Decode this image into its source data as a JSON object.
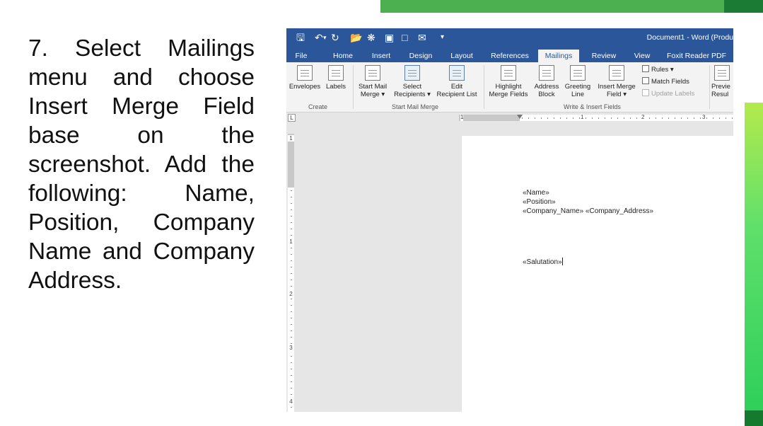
{
  "instruction_text": "7. Select Mailings menu and choose Insert Merge Field base on the screenshot. Add the following: Name, Position, Company Name and Company Address.",
  "word": {
    "window_title": "Document1 - Word (Produ",
    "quick_access_icons": [
      "save-icon",
      "undo-icon",
      "redo-icon",
      "open-icon",
      "customize-icon",
      "print-preview-icon",
      "new-document-icon",
      "email-icon",
      "dropdown-icon"
    ],
    "tabs": [
      "File",
      "Home",
      "Insert",
      "Design",
      "Layout",
      "References",
      "Mailings",
      "Review",
      "View",
      "Foxit Reader PDF"
    ],
    "active_tab": "Mailings",
    "ribbon": {
      "create": {
        "label": "Create",
        "envelopes": "Envelopes",
        "labels": "Labels"
      },
      "start_mail_merge": {
        "label": "Start Mail Merge",
        "start_line1": "Start Mail",
        "start_line2": "Merge ▾",
        "select_line1": "Select",
        "select_line2": "Recipients ▾",
        "edit_line1": "Edit",
        "edit_line2": "Recipient List"
      },
      "write_insert": {
        "label": "Write & Insert Fields",
        "highlight_line1": "Highlight",
        "highlight_line2": "Merge Fields",
        "address_line1": "Address",
        "address_line2": "Block",
        "greeting_line1": "Greeting",
        "greeting_line2": "Line",
        "insert_line1": "Insert Merge",
        "insert_line2": "Field ▾",
        "rules": "Rules ▾",
        "match_fields": "Match Fields",
        "update_labels": "Update Labels"
      },
      "preview": {
        "line1": "Previe",
        "line2": "Resul"
      }
    },
    "ruler": {
      "tab_selector": "L",
      "h_numbers": [
        "1",
        "1",
        "2",
        "3"
      ],
      "v_numbers": [
        "1",
        "1",
        "2",
        "3",
        "4"
      ]
    },
    "document": {
      "line1": "«Name»",
      "line2": "«Position»",
      "line3": "«Company_Name» «Company_Address»",
      "line4": "«Salutation»"
    }
  },
  "colors": {
    "word_blue": "#2b579a",
    "ribbon_bg": "#f3f3f3",
    "green_accent": "#4caf50",
    "green_dark": "#1b7a34"
  }
}
